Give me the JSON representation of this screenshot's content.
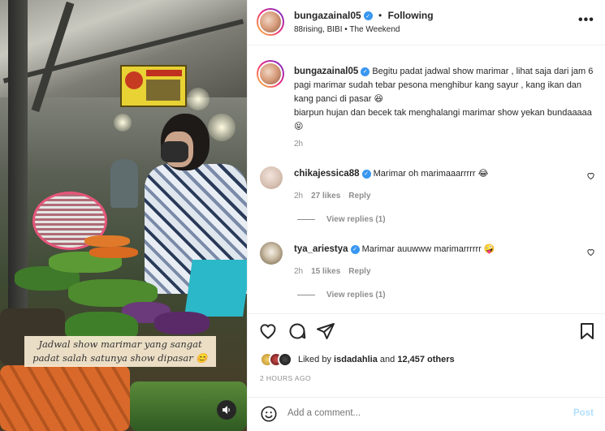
{
  "header": {
    "username": "bungazainal05",
    "separator": "•",
    "follow_label": "Following",
    "audio": "88rising, BIBI",
    "audio_separator": "•",
    "audio_track": "The Weekend",
    "more_label": "•••"
  },
  "media": {
    "overlay_caption_line1": "Jadwal show marimar yang sangat",
    "overlay_caption_line2": "padat salah satunya show dipasar 😊"
  },
  "caption": {
    "username": "bungazainal05",
    "text1": "Begitu padat jadwal show marimar , lihat saja dari jam 6 pagi marimar sudah tebar pesona menghibur kang sayur , kang ikan dan kang panci di pasar 😆",
    "text2": "biarpun hujan dan becek tak menghalangi marimar show yekan bundaaaaa 😝",
    "time": "2h"
  },
  "comments": [
    {
      "username": "chikajessica88",
      "text": "Marimar oh marimaaarrrrr 😂",
      "time": "2h",
      "likes": "27 likes",
      "reply_label": "Reply",
      "view_replies": "View replies (1)"
    },
    {
      "username": "tya_ariestya",
      "text": "Marimar auuwww marimarrrrrr 🤪",
      "time": "2h",
      "likes": "15 likes",
      "reply_label": "Reply",
      "view_replies": "View replies (1)"
    }
  ],
  "likes": {
    "prefix": "Liked by",
    "user": "isdadahlia",
    "middle": "and",
    "others": "12,457 others"
  },
  "post_time": "2 HOURS AGO",
  "add_comment": {
    "placeholder": "Add a comment...",
    "post_label": "Post"
  },
  "colors": {
    "verified": "#3897f0",
    "muted": "#8e8e8e",
    "post_disabled": "#b2dffc"
  }
}
